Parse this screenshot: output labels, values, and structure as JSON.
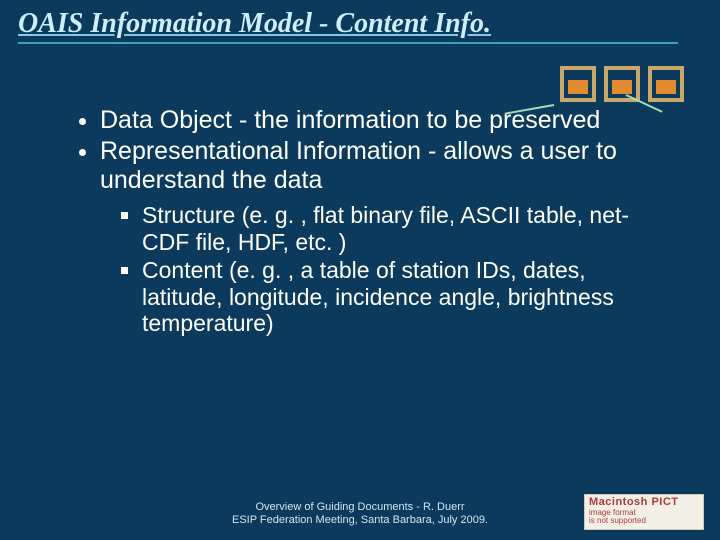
{
  "title": "OAIS Information Model - Content Info.",
  "bullets": {
    "b1": "Data Object - the information to be preserved",
    "b2": "Representational Information - allows a user to understand the data",
    "s1": "Structure  (e. g. , flat binary file, ASCII table, net-CDF file, HDF, etc. )",
    "s2": "Content (e. g. , a table of station IDs, dates, latitude, longitude, incidence angle, brightness temperature)"
  },
  "footer": {
    "line1": "Overview of Guiding Documents -  R. Duerr",
    "line2": "ESIP Federation Meeting, Santa Barbara, July 2009."
  },
  "badge": {
    "l1": "Macintosh PICT",
    "l2": "image format",
    "l3": "is not supported"
  }
}
